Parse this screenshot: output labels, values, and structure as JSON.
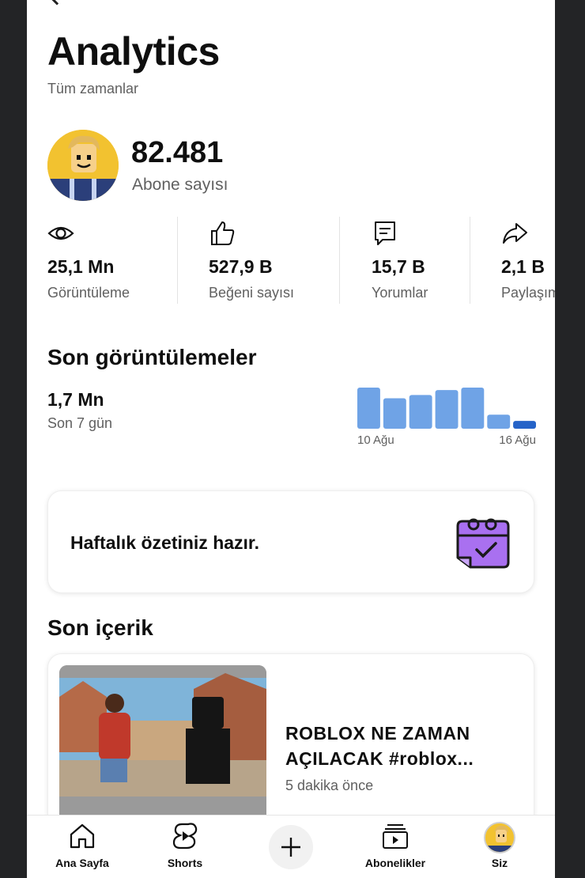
{
  "header": {
    "title": "Analytics",
    "subtitle": "Tüm zamanlar"
  },
  "channel": {
    "subscriber_count": "82.481",
    "subscriber_label": "Abone sayısı"
  },
  "stats": [
    {
      "icon": "eye-icon",
      "value": "25,1 Mn",
      "label": "Görüntüleme"
    },
    {
      "icon": "thumbs-up-icon",
      "value": "527,9 B",
      "label": "Beğeni sayısı"
    },
    {
      "icon": "comment-icon",
      "value": "15,7 B",
      "label": "Yorumlar"
    },
    {
      "icon": "share-icon",
      "value": "2,1 B",
      "label": "Paylaşım"
    }
  ],
  "recent_views": {
    "heading": "Son görüntülemeler",
    "value": "1,7 Mn",
    "period": "Son 7 gün",
    "chart_data": {
      "type": "bar",
      "x_start_label": "10 Ağu",
      "x_end_label": "16 Ağu",
      "relative_values": [
        1.0,
        0.74,
        0.82,
        0.94,
        1.0,
        0.34,
        0.19
      ],
      "colors": {
        "bar": "#6fa3e6",
        "last_bar": "#2563c8"
      }
    }
  },
  "weekly_summary": {
    "text": "Haftalık özetiniz hazır.",
    "icon": "calendar-check-icon"
  },
  "recent_content": {
    "heading": "Son içerik",
    "video_title": "ROBLOX NE ZAMAN AÇILACAK #roblox...",
    "published": "5 dakika önce"
  },
  "bottom_nav": {
    "home": "Ana Sayfa",
    "shorts": "Shorts",
    "subscriptions": "Abonelikler",
    "you": "Siz"
  },
  "colors": {
    "text_primary": "#0f0f0f",
    "text_secondary": "#606060",
    "accent_purple": "#a970f0"
  }
}
